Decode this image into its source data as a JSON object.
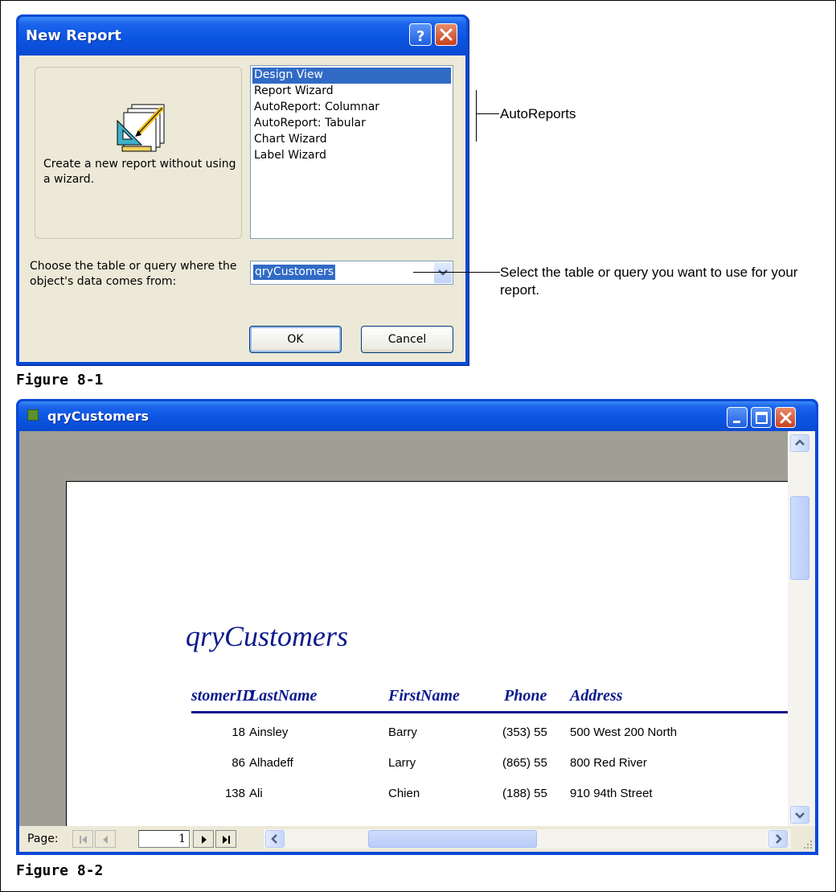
{
  "dialog": {
    "title": "New Report",
    "description": "Create a new report without using a wizard.",
    "list_items": [
      "Design View",
      "Report Wizard",
      "AutoReport:  Columnar",
      "AutoReport:  Tabular",
      "Chart Wizard",
      "Label Wizard"
    ],
    "selected_item": "Design View",
    "source_label": "Choose the table or query where the object's data comes from:",
    "source_value": "qryCustomers",
    "ok_label": "OK",
    "cancel_label": "Cancel"
  },
  "callouts": {
    "autoreports": "AutoReports",
    "select_table": "Select the table or query you want to use for your report."
  },
  "figures": {
    "fig1": "Figure 8-1",
    "fig2": "Figure 8-2"
  },
  "window": {
    "title": "qryCustomers",
    "page_label": "Page:",
    "page_number": "1"
  },
  "report": {
    "title": "qryCustomers",
    "columns": [
      "stomerID",
      "LastName",
      "FirstName",
      "Phone",
      "Address"
    ],
    "rows": [
      [
        "18",
        "Ainsley",
        "Barry",
        "(353) 55",
        "500 West 200 North"
      ],
      [
        "86",
        "Alhadeff",
        "Larry",
        "(865) 55",
        "800 Red River"
      ],
      [
        "138",
        "Ali",
        "Chien",
        "(188) 55",
        "910 94th Street"
      ]
    ]
  },
  "colors": {
    "titlebar": "#0a49d6",
    "selection": "#316ac5",
    "report_text": "#0c1a8c",
    "dialog_bg": "#ece9d8"
  }
}
